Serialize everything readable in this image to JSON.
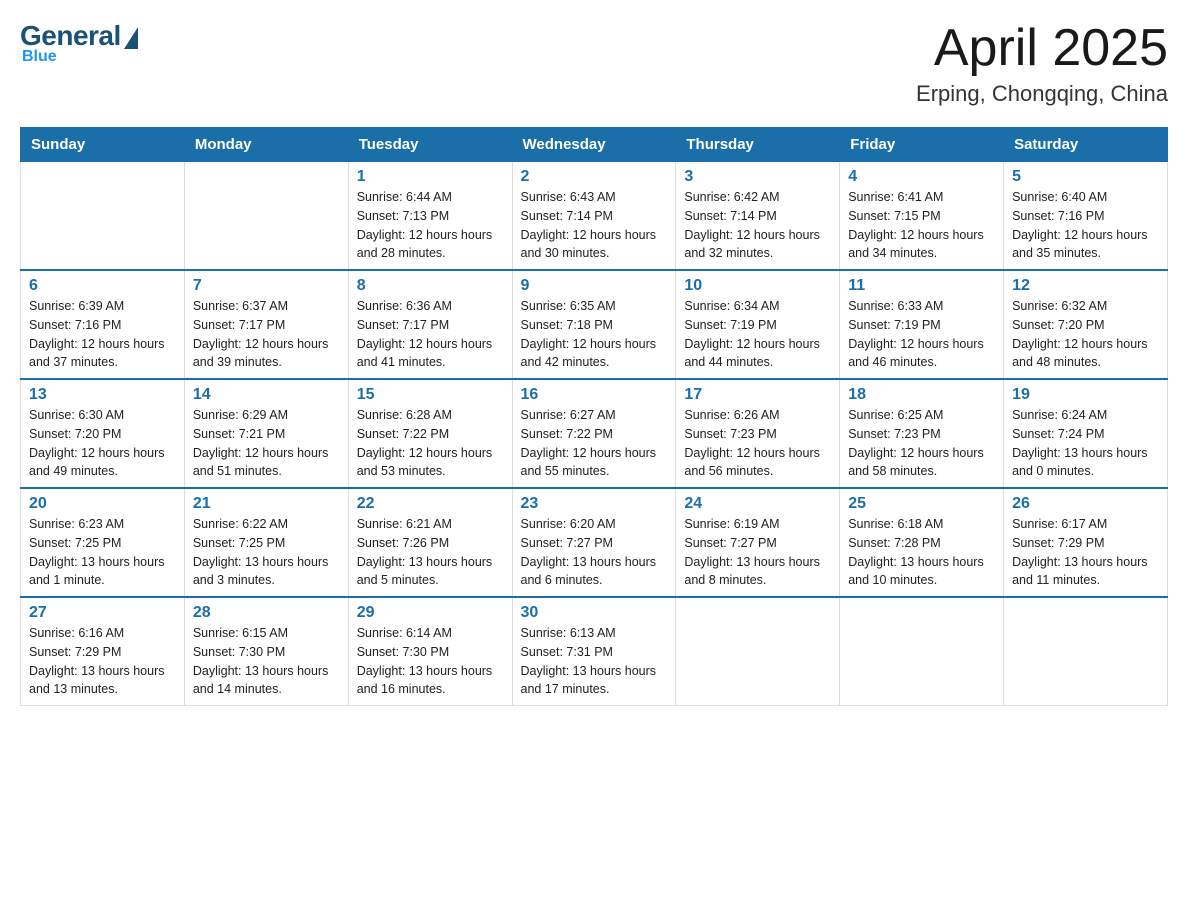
{
  "header": {
    "logo": {
      "general": "General",
      "blue": "Blue"
    },
    "title": "April 2025",
    "location": "Erping, Chongqing, China"
  },
  "days_of_week": [
    "Sunday",
    "Monday",
    "Tuesday",
    "Wednesday",
    "Thursday",
    "Friday",
    "Saturday"
  ],
  "weeks": [
    [
      {
        "day": "",
        "sunrise": "",
        "sunset": "",
        "daylight": ""
      },
      {
        "day": "",
        "sunrise": "",
        "sunset": "",
        "daylight": ""
      },
      {
        "day": "1",
        "sunrise": "Sunrise: 6:44 AM",
        "sunset": "Sunset: 7:13 PM",
        "daylight": "Daylight: 12 hours and 28 minutes."
      },
      {
        "day": "2",
        "sunrise": "Sunrise: 6:43 AM",
        "sunset": "Sunset: 7:14 PM",
        "daylight": "Daylight: 12 hours and 30 minutes."
      },
      {
        "day": "3",
        "sunrise": "Sunrise: 6:42 AM",
        "sunset": "Sunset: 7:14 PM",
        "daylight": "Daylight: 12 hours and 32 minutes."
      },
      {
        "day": "4",
        "sunrise": "Sunrise: 6:41 AM",
        "sunset": "Sunset: 7:15 PM",
        "daylight": "Daylight: 12 hours and 34 minutes."
      },
      {
        "day": "5",
        "sunrise": "Sunrise: 6:40 AM",
        "sunset": "Sunset: 7:16 PM",
        "daylight": "Daylight: 12 hours and 35 minutes."
      }
    ],
    [
      {
        "day": "6",
        "sunrise": "Sunrise: 6:39 AM",
        "sunset": "Sunset: 7:16 PM",
        "daylight": "Daylight: 12 hours and 37 minutes."
      },
      {
        "day": "7",
        "sunrise": "Sunrise: 6:37 AM",
        "sunset": "Sunset: 7:17 PM",
        "daylight": "Daylight: 12 hours and 39 minutes."
      },
      {
        "day": "8",
        "sunrise": "Sunrise: 6:36 AM",
        "sunset": "Sunset: 7:17 PM",
        "daylight": "Daylight: 12 hours and 41 minutes."
      },
      {
        "day": "9",
        "sunrise": "Sunrise: 6:35 AM",
        "sunset": "Sunset: 7:18 PM",
        "daylight": "Daylight: 12 hours and 42 minutes."
      },
      {
        "day": "10",
        "sunrise": "Sunrise: 6:34 AM",
        "sunset": "Sunset: 7:19 PM",
        "daylight": "Daylight: 12 hours and 44 minutes."
      },
      {
        "day": "11",
        "sunrise": "Sunrise: 6:33 AM",
        "sunset": "Sunset: 7:19 PM",
        "daylight": "Daylight: 12 hours and 46 minutes."
      },
      {
        "day": "12",
        "sunrise": "Sunrise: 6:32 AM",
        "sunset": "Sunset: 7:20 PM",
        "daylight": "Daylight: 12 hours and 48 minutes."
      }
    ],
    [
      {
        "day": "13",
        "sunrise": "Sunrise: 6:30 AM",
        "sunset": "Sunset: 7:20 PM",
        "daylight": "Daylight: 12 hours and 49 minutes."
      },
      {
        "day": "14",
        "sunrise": "Sunrise: 6:29 AM",
        "sunset": "Sunset: 7:21 PM",
        "daylight": "Daylight: 12 hours and 51 minutes."
      },
      {
        "day": "15",
        "sunrise": "Sunrise: 6:28 AM",
        "sunset": "Sunset: 7:22 PM",
        "daylight": "Daylight: 12 hours and 53 minutes."
      },
      {
        "day": "16",
        "sunrise": "Sunrise: 6:27 AM",
        "sunset": "Sunset: 7:22 PM",
        "daylight": "Daylight: 12 hours and 55 minutes."
      },
      {
        "day": "17",
        "sunrise": "Sunrise: 6:26 AM",
        "sunset": "Sunset: 7:23 PM",
        "daylight": "Daylight: 12 hours and 56 minutes."
      },
      {
        "day": "18",
        "sunrise": "Sunrise: 6:25 AM",
        "sunset": "Sunset: 7:23 PM",
        "daylight": "Daylight: 12 hours and 58 minutes."
      },
      {
        "day": "19",
        "sunrise": "Sunrise: 6:24 AM",
        "sunset": "Sunset: 7:24 PM",
        "daylight": "Daylight: 13 hours and 0 minutes."
      }
    ],
    [
      {
        "day": "20",
        "sunrise": "Sunrise: 6:23 AM",
        "sunset": "Sunset: 7:25 PM",
        "daylight": "Daylight: 13 hours and 1 minute."
      },
      {
        "day": "21",
        "sunrise": "Sunrise: 6:22 AM",
        "sunset": "Sunset: 7:25 PM",
        "daylight": "Daylight: 13 hours and 3 minutes."
      },
      {
        "day": "22",
        "sunrise": "Sunrise: 6:21 AM",
        "sunset": "Sunset: 7:26 PM",
        "daylight": "Daylight: 13 hours and 5 minutes."
      },
      {
        "day": "23",
        "sunrise": "Sunrise: 6:20 AM",
        "sunset": "Sunset: 7:27 PM",
        "daylight": "Daylight: 13 hours and 6 minutes."
      },
      {
        "day": "24",
        "sunrise": "Sunrise: 6:19 AM",
        "sunset": "Sunset: 7:27 PM",
        "daylight": "Daylight: 13 hours and 8 minutes."
      },
      {
        "day": "25",
        "sunrise": "Sunrise: 6:18 AM",
        "sunset": "Sunset: 7:28 PM",
        "daylight": "Daylight: 13 hours and 10 minutes."
      },
      {
        "day": "26",
        "sunrise": "Sunrise: 6:17 AM",
        "sunset": "Sunset: 7:29 PM",
        "daylight": "Daylight: 13 hours and 11 minutes."
      }
    ],
    [
      {
        "day": "27",
        "sunrise": "Sunrise: 6:16 AM",
        "sunset": "Sunset: 7:29 PM",
        "daylight": "Daylight: 13 hours and 13 minutes."
      },
      {
        "day": "28",
        "sunrise": "Sunrise: 6:15 AM",
        "sunset": "Sunset: 7:30 PM",
        "daylight": "Daylight: 13 hours and 14 minutes."
      },
      {
        "day": "29",
        "sunrise": "Sunrise: 6:14 AM",
        "sunset": "Sunset: 7:30 PM",
        "daylight": "Daylight: 13 hours and 16 minutes."
      },
      {
        "day": "30",
        "sunrise": "Sunrise: 6:13 AM",
        "sunset": "Sunset: 7:31 PM",
        "daylight": "Daylight: 13 hours and 17 minutes."
      },
      {
        "day": "",
        "sunrise": "",
        "sunset": "",
        "daylight": ""
      },
      {
        "day": "",
        "sunrise": "",
        "sunset": "",
        "daylight": ""
      },
      {
        "day": "",
        "sunrise": "",
        "sunset": "",
        "daylight": ""
      }
    ]
  ]
}
